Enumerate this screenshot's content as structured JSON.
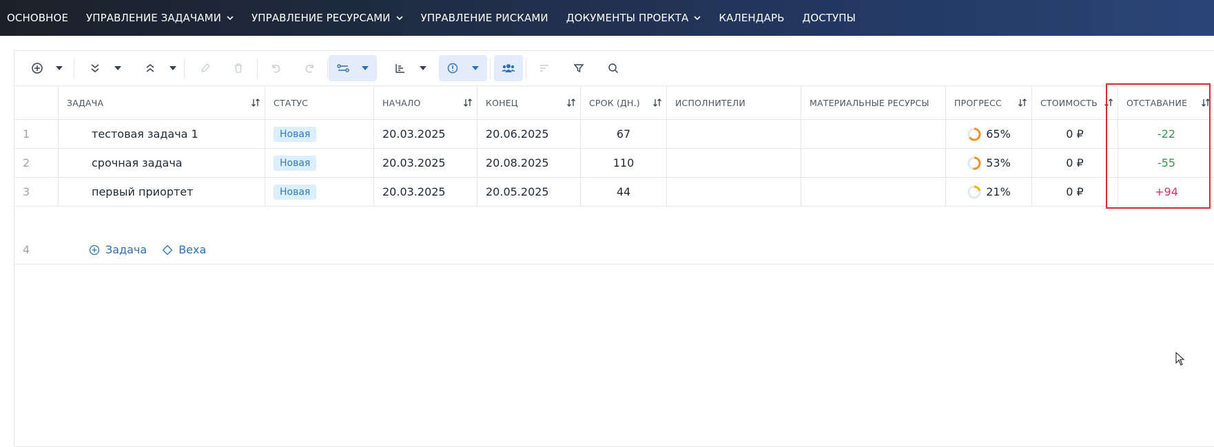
{
  "nav": {
    "items": [
      {
        "label": "ОСНОВНОЕ",
        "dropdown": false
      },
      {
        "label": "УПРАВЛЕНИЕ ЗАДАЧАМИ",
        "dropdown": true
      },
      {
        "label": "УПРАВЛЕНИЕ РЕСУРСАМИ",
        "dropdown": true
      },
      {
        "label": "УПРАВЛЕНИЕ РИСКАМИ",
        "dropdown": false
      },
      {
        "label": "ДОКУМЕНТЫ ПРОЕКТА",
        "dropdown": true
      },
      {
        "label": "КАЛЕНДАРЬ",
        "dropdown": false
      },
      {
        "label": "ДОСТУПЫ",
        "dropdown": false
      }
    ]
  },
  "toolbar": {
    "icons": [
      "add-circle-icon",
      "expand-all-icon",
      "collapse-all-icon",
      "edit-icon",
      "delete-icon",
      "undo-icon",
      "redo-icon",
      "dependencies-icon",
      "chart-icon",
      "info-icon",
      "team-icon",
      "sort-icon",
      "filter-icon",
      "search-icon"
    ]
  },
  "table": {
    "columns": {
      "task": "ЗАДАЧА",
      "status": "СТАТУС",
      "start": "НАЧАЛО",
      "end": "КОНЕЦ",
      "duration": "СРОК (ДН.)",
      "assignees": "ИСПОЛНИТЕЛИ",
      "materials": "МАТЕРИАЛЬНЫЕ РЕСУРСЫ",
      "progress": "ПРОГРЕСС",
      "cost": "СТОИМОСТЬ",
      "lag": "ОТСТАВАНИЕ"
    },
    "rows": [
      {
        "num": "1",
        "task": "тестовая задача 1",
        "status": "Новая",
        "start": "20.03.2025",
        "end": "20.06.2025",
        "duration": "67",
        "assignees": "",
        "materials": "",
        "progress": "65%",
        "progress_value": 0.65,
        "cost": "0 ₽",
        "lag": "-22"
      },
      {
        "num": "2",
        "task": "срочная задача",
        "status": "Новая",
        "start": "20.03.2025",
        "end": "20.08.2025",
        "duration": "110",
        "assignees": "",
        "materials": "",
        "progress": "53%",
        "progress_value": 0.53,
        "cost": "0 ₽",
        "lag": "-55"
      },
      {
        "num": "3",
        "task": "первый приортет",
        "status": "Новая",
        "start": "20.03.2025",
        "end": "20.05.2025",
        "duration": "44",
        "assignees": "",
        "materials": "",
        "progress": "21%",
        "progress_value": 0.21,
        "cost": "0 ₽",
        "lag": "+94"
      }
    ],
    "add_row": {
      "num": "4",
      "add_task": "Задача",
      "add_milestone": "Веха"
    }
  },
  "colors": {
    "accent": "#2f6fb3",
    "badge_bg": "#dcefff",
    "positive": "#2e9b47",
    "negative": "#d6336c",
    "progress_orange": "#f0932b",
    "progress_yellow": "#f5b400",
    "highlight": "#d92b2b"
  }
}
